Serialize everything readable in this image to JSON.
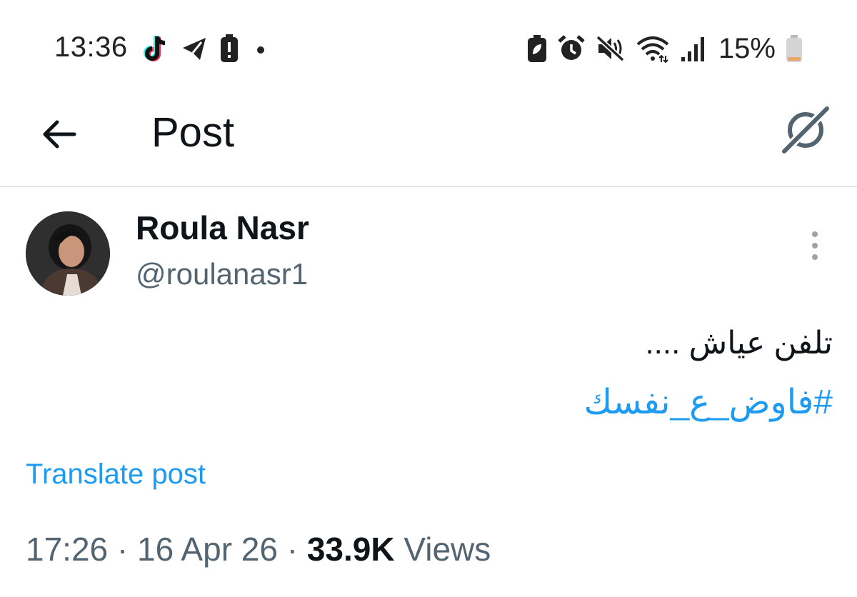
{
  "status_bar": {
    "time": "13:36",
    "left_icons": [
      "tiktok-icon",
      "telegram-icon",
      "battery-alert-icon",
      "dot-icon"
    ],
    "right_icons": [
      "battery-saver-icon",
      "alarm-icon",
      "mute-icon",
      "wifi-icon",
      "signal-icon"
    ],
    "battery_text": "15%"
  },
  "header": {
    "title": "Post",
    "back_icon": "arrow-left-icon",
    "grok_icon": "grok-icon"
  },
  "post": {
    "author_name": "Roula Nasr",
    "author_handle": "@roulanasr1",
    "text": "تلفن عياش ....",
    "hashtag": "#فاوض_ع_نفسك",
    "translate_label": "Translate post",
    "time": "17:26",
    "separator": "·",
    "date": "16 Apr 26",
    "views_count": "33.9K",
    "views_label": "Views"
  },
  "colors": {
    "link": "#1d9bf0",
    "text_primary": "#0f1419",
    "text_secondary": "#536471",
    "divider": "#e6e6e6"
  }
}
